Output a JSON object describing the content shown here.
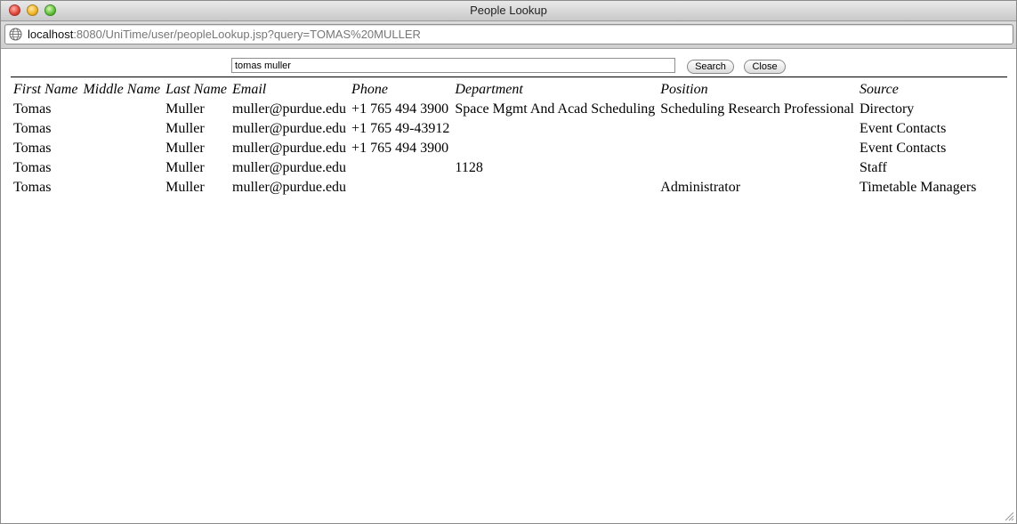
{
  "window": {
    "title": "People Lookup"
  },
  "urlbar": {
    "host": "localhost",
    "path": ":8080/UniTime/user/peopleLookup.jsp?query=TOMAS%20MULLER",
    "icon": "globe-icon"
  },
  "search": {
    "value": "tomas muller",
    "search_label": "Search",
    "close_label": "Close"
  },
  "table": {
    "headers": [
      "First Name",
      "Middle Name",
      "Last Name",
      "Email",
      "Phone",
      "Department",
      "Position",
      "Source"
    ],
    "rows": [
      [
        "Tomas",
        "",
        "Muller",
        "muller@purdue.edu",
        "+1 765 494 3900",
        "Space Mgmt And Acad Scheduling",
        "Scheduling Research Professional",
        "Directory"
      ],
      [
        "Tomas",
        "",
        "Muller",
        "muller@purdue.edu",
        "+1 765 49-43912",
        "",
        "",
        "Event Contacts"
      ],
      [
        "Tomas",
        "",
        "Muller",
        "muller@purdue.edu",
        "+1 765 494 3900",
        "",
        "",
        "Event Contacts"
      ],
      [
        "Tomas",
        "",
        "Muller",
        "muller@purdue.edu",
        "",
        "1128",
        "",
        "Staff"
      ],
      [
        "Tomas",
        "",
        "Muller",
        "muller@purdue.edu",
        "",
        "",
        "Administrator",
        "Timetable Managers"
      ]
    ]
  }
}
